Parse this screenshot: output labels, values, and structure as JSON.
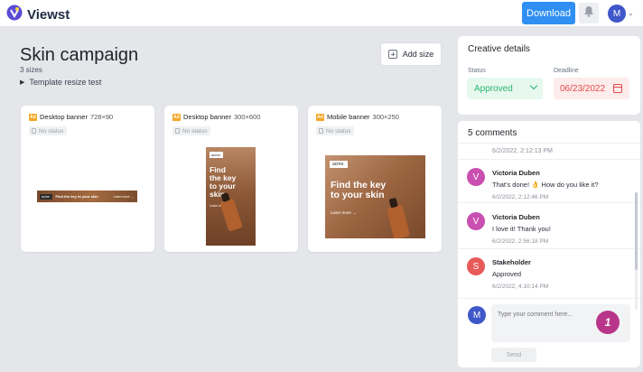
{
  "topbar": {
    "app_name": "Viewst",
    "download_label": "Download",
    "avatar_initial": "M"
  },
  "campaign": {
    "title": "Skin campaign",
    "sizes_count": "3 sizes",
    "template_label": "Template resize test",
    "add_size_label": "Add size"
  },
  "cards": [
    {
      "badge": "Ad",
      "name": "Desktop banner",
      "dims": "728×90",
      "status": "No status"
    },
    {
      "badge": "Ad",
      "name": "Desktop banner",
      "dims": "300×600",
      "status": "No status"
    },
    {
      "badge": "Ad",
      "name": "Mobile banner",
      "dims": "300×250",
      "status": "No status"
    }
  ],
  "banners": {
    "brand": "acme.",
    "headline": "Find the key to your skin",
    "headline_lines": [
      "Find",
      "the key",
      "to your",
      "skin"
    ],
    "headline_lines_wide": [
      "Find the key",
      "to your skin"
    ],
    "cta": "Learn more →"
  },
  "creative_details": {
    "title": "Creative details",
    "status_label": "Status",
    "status_value": "Approved",
    "deadline_label": "Deadline",
    "deadline_value": "06/23/2022"
  },
  "comments": {
    "title": "5 comments",
    "first_timestamp": "6/2/2022, 2:12:13 PM",
    "items": [
      {
        "initial": "V",
        "author": "Victoria Duben",
        "text": "That's done! 👌 How do you like it?",
        "time": "6/2/2022, 2:12:46 PM",
        "color": "#c94fb0"
      },
      {
        "initial": "V",
        "author": "Victoria Duben",
        "text": "I love it! Thank you!",
        "time": "6/2/2022, 2:56:18 PM",
        "color": "#c94fb0"
      },
      {
        "initial": "S",
        "author": "Stakeholder",
        "text": "Approved",
        "time": "6/2/2022, 4:10:14 PM",
        "color": "#e85a5a"
      }
    ],
    "input_placeholder": "Type your comment here...",
    "my_initial": "M",
    "counter": "1",
    "send_label": "Send"
  },
  "colors": {
    "accent": "#2f8ff2",
    "approved": "#2bb673",
    "deadline": "#e54848",
    "counter_badge": "#b8368a"
  }
}
